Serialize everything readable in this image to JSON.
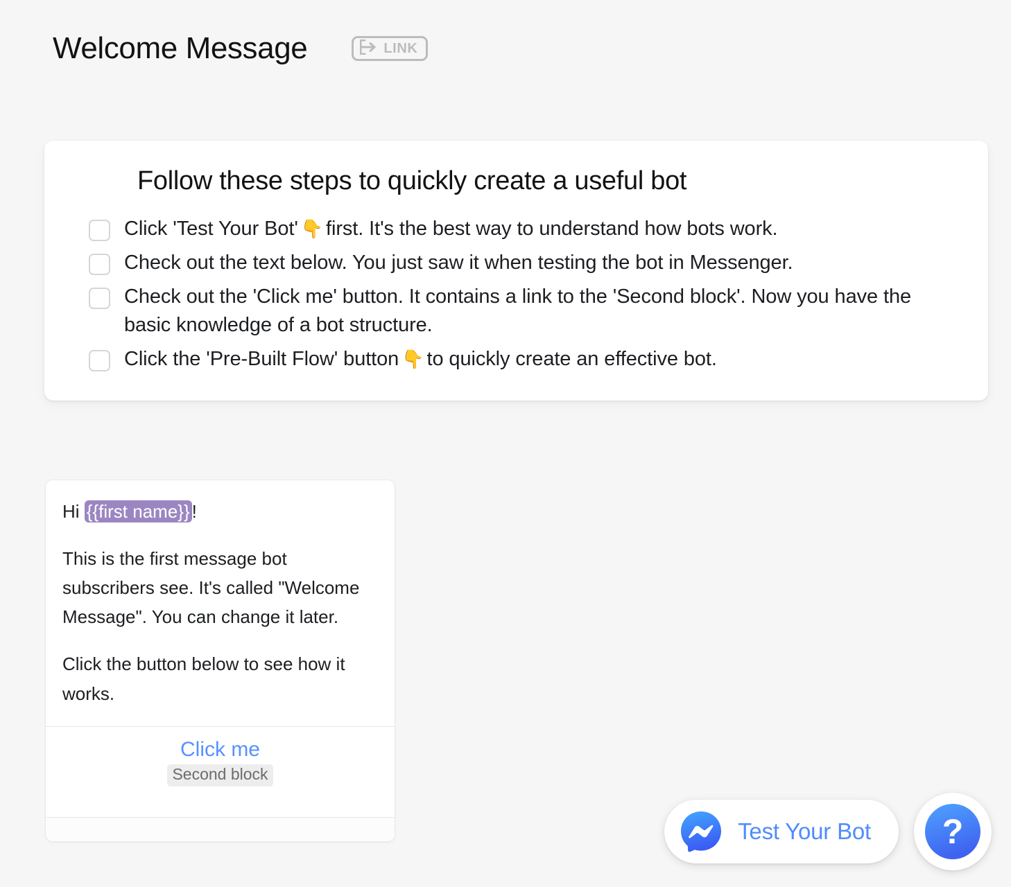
{
  "header": {
    "title": "Welcome Message",
    "link_badge": {
      "label": "LINK",
      "icon": "arrow-into-bracket-icon"
    }
  },
  "checklist": {
    "heading": "Follow these steps to quickly create a useful bot",
    "items": [
      {
        "checked": false,
        "text_before": "Click 'Test Your Bot'",
        "emoji": "👇",
        "text_after": "first. It's the best way to understand how bots work."
      },
      {
        "checked": false,
        "text_before": "Check out the text below. You just saw it when testing the bot in Messenger.",
        "emoji": "",
        "text_after": ""
      },
      {
        "checked": false,
        "text_before": "Check out the 'Click me' button. It contains a link to the 'Second block'. Now you have the basic knowledge of a bot structure.",
        "emoji": "",
        "text_after": ""
      },
      {
        "checked": false,
        "text_before": "Click the 'Pre-Built Flow' button",
        "emoji": "👇",
        "text_after": "to quickly create an effective bot."
      }
    ]
  },
  "message_card": {
    "greeting_prefix": "Hi ",
    "variable_token": "{{first name}}",
    "greeting_suffix": "!",
    "paragraph_1": "This is the first message bot subscribers see. It's called \"Welcome Message\". You can change it later.",
    "paragraph_2": "Click the button below to see how it works.",
    "button": {
      "label": "Click me",
      "target_badge": "Second block"
    }
  },
  "floating": {
    "test_bot": {
      "label": "Test Your Bot",
      "icon": "messenger-logo-icon"
    },
    "help": {
      "label": "?",
      "icon": "question-mark-icon"
    }
  },
  "colors": {
    "background": "#f6f6f6",
    "card": "#ffffff",
    "accent_blue": "#5890ff",
    "variable_purple": "#9b86c2",
    "muted_gray": "#bcbcbc"
  }
}
